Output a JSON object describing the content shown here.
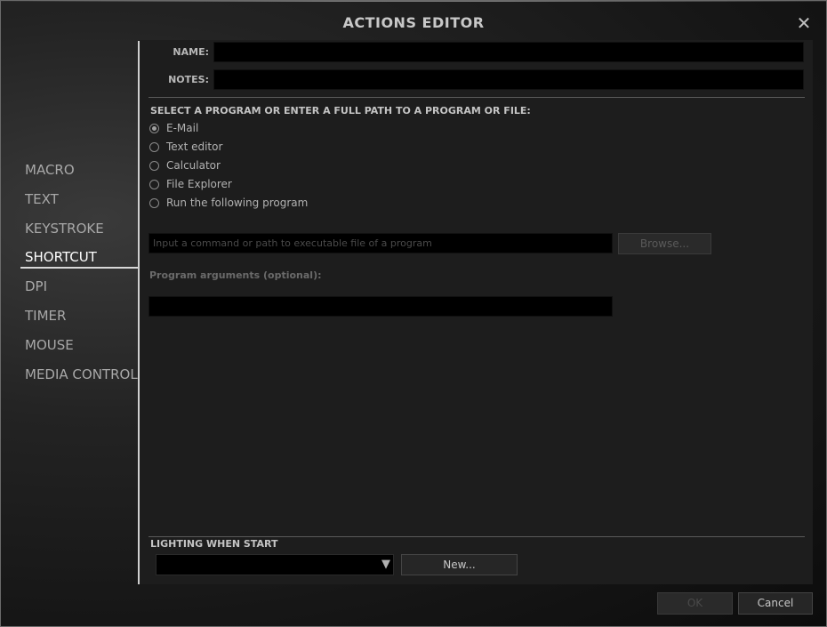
{
  "window": {
    "title": "ACTIONS EDITOR",
    "close_glyph": "✕"
  },
  "sidebar": {
    "items": [
      {
        "label": "MACRO",
        "active": false
      },
      {
        "label": "TEXT",
        "active": false
      },
      {
        "label": "KEYSTROKE",
        "active": false
      },
      {
        "label": "SHORTCUT",
        "active": true
      },
      {
        "label": "DPI",
        "active": false
      },
      {
        "label": "TIMER",
        "active": false
      },
      {
        "label": "MOUSE",
        "active": false
      },
      {
        "label": "MEDIA CONTROL",
        "active": false
      }
    ]
  },
  "form": {
    "name_label": "NAME:",
    "name_value": "",
    "notes_label": "NOTES:",
    "notes_value": "",
    "program_heading": "SELECT A PROGRAM OR ENTER A FULL PATH TO A PROGRAM OR FILE:",
    "program_options": [
      {
        "label": "E-Mail",
        "checked": true
      },
      {
        "label": "Text editor",
        "checked": false
      },
      {
        "label": "Calculator",
        "checked": false
      },
      {
        "label": "File Explorer",
        "checked": false
      },
      {
        "label": "Run the following program",
        "checked": false
      }
    ],
    "command_placeholder": "Input a command or path to executable file of a program",
    "browse_label": "Browse...",
    "arguments_label": "Program arguments (optional):",
    "arguments_value": "",
    "lighting_label": "LIGHTING WHEN START",
    "lighting_selected": "",
    "lighting_arrow": "▼",
    "new_label": "New..."
  },
  "footer": {
    "ok_label": "OK",
    "cancel_label": "Cancel"
  }
}
